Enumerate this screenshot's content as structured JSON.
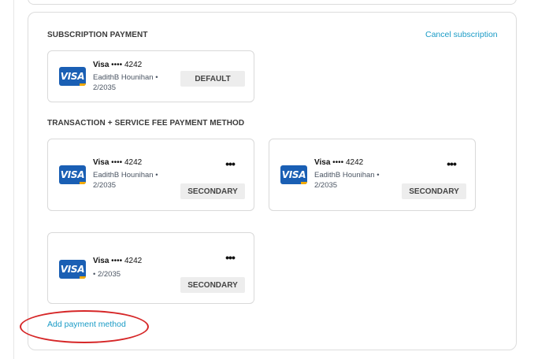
{
  "subscription": {
    "title": "SUBSCRIPTION PAYMENT",
    "cancel_link": "Cancel subscription",
    "card": {
      "logo": "VISA",
      "brand": "Visa",
      "mask": "•••• 4242",
      "holder": "EadithB Hounihan • 2/2035",
      "badge": "DEFAULT"
    }
  },
  "transaction": {
    "title": "TRANSACTION + SERVICE FEE PAYMENT METHOD",
    "cards": [
      {
        "logo": "VISA",
        "brand": "Visa",
        "mask": "•••• 4242",
        "holder": "EadithB Hounihan • 2/2035",
        "badge": "SECONDARY",
        "menu": "•••"
      },
      {
        "logo": "VISA",
        "brand": "Visa",
        "mask": "•••• 4242",
        "holder": "EadithB Hounihan • 2/2035",
        "badge": "SECONDARY",
        "menu": "•••"
      },
      {
        "logo": "VISA",
        "brand": "Visa",
        "mask": "•••• 4242",
        "holder": "• 2/2035",
        "badge": "SECONDARY",
        "menu": "•••"
      }
    ]
  },
  "add_payment_link": "Add payment method",
  "colors": {
    "link": "#1a9bc6",
    "visa_blue": "#1a5fb4",
    "annotation_red": "#d62728",
    "badge_bg": "#ededed"
  }
}
